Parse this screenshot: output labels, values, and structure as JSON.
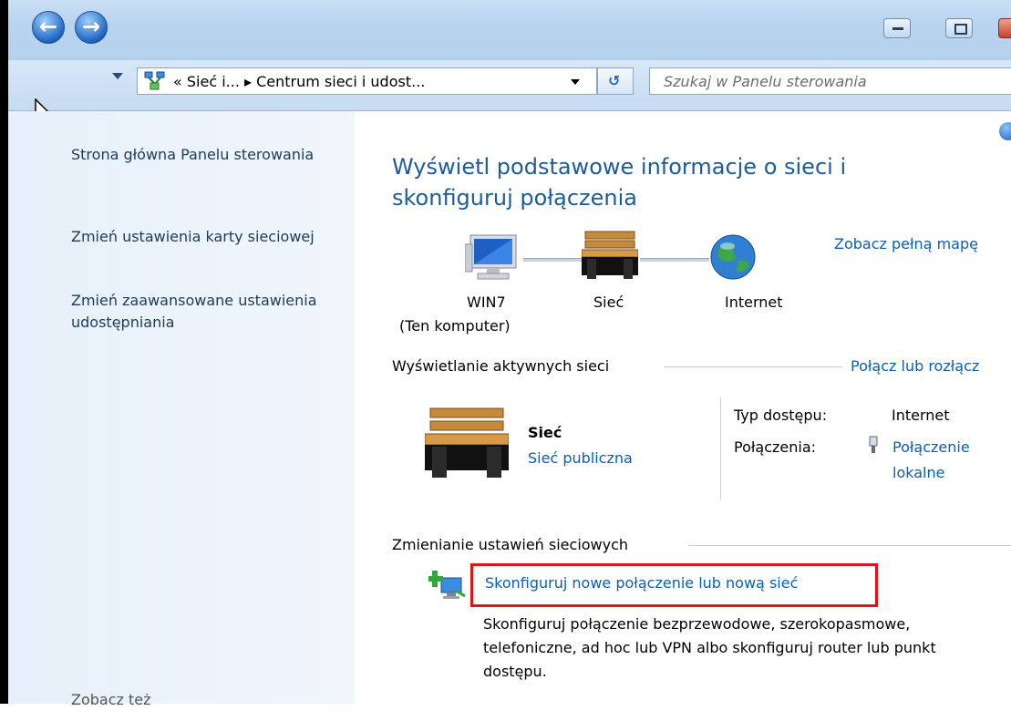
{
  "window": {
    "minimize_label": "–",
    "maximize_label": "□"
  },
  "nav": {
    "back_glyph": "←",
    "forward_glyph": "→",
    "address_text": "« Sieć i... ▸ Centrum sieci i udost...",
    "search_placeholder": "Szukaj w Panelu sterowania"
  },
  "sidebar": {
    "items": [
      {
        "label": "Strona główna Panelu sterowania"
      },
      {
        "label": "Zmień ustawienia karty sieciowej"
      },
      {
        "label": "Zmień zaawansowane ustawienia udostępniania"
      },
      {
        "label": "Zobacz też"
      }
    ]
  },
  "main": {
    "title": "Wyświetl podstawowe informacje o sieci i skonfiguruj połączenia",
    "full_map_link": "Zobacz pełną mapę",
    "map": {
      "computer_label": "WIN7",
      "computer_sub": "(Ten komputer)",
      "network_label": "Sieć",
      "internet_label": "Internet"
    },
    "active_section": "Wyświetlanie aktywnych sieci",
    "connect_link": "Połącz lub rozłącz",
    "network_name": "Sieć",
    "network_type": "Sieć publiczna",
    "access_type_label": "Typ dostępu:",
    "access_type_value": "Internet",
    "connections_label": "Połączenia:",
    "connections_value_1": "Połączenie",
    "connections_value_2": "lokalne",
    "change_section": "Zmienianie ustawień sieciowych",
    "setup_link": "Skonfiguruj nowe połączenie lub nową sieć",
    "setup_desc": "Skonfiguruj połączenie bezprzewodowe, szerokopasmowe, telefoniczne, ad hoc lub VPN albo skonfiguruj router lub punkt dostępu."
  },
  "colors": {
    "link": "#0b5fb4",
    "title": "#1e5b9a",
    "highlight": "#e0121c"
  }
}
